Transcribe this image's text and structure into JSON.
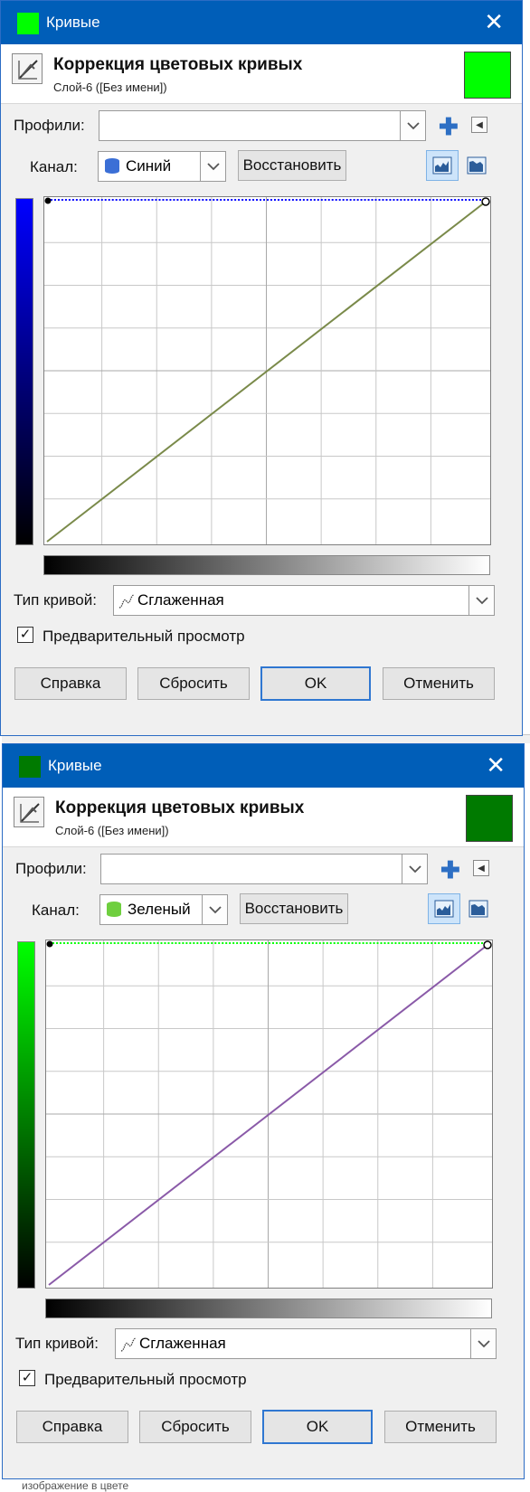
{
  "dialogs": [
    {
      "window_title": "Кривые",
      "color": "#00ff00",
      "header_title": "Коррекция цветовых кривых",
      "header_subtitle": "Слой-6 ([Без имени])",
      "profiles_label": "Профили:",
      "profiles_value": "",
      "channel_label": "Канал:",
      "channel_value": "Синий",
      "channel_icon": "blue-channel-icon",
      "channel_icon_color": "#3b6fd6",
      "reset_channel_label": "Восстановить",
      "gradient_color": "#0000ff",
      "curve_color": "#7a8a4a",
      "curve_type_label": "Тип кривой:",
      "curve_type_value": "Сглаженная",
      "preview_label": "Предварительный просмотр",
      "preview_checked": true,
      "buttons": {
        "help": "Справка",
        "reset": "Сбросить",
        "ok": "OK",
        "cancel": "Отменить"
      }
    },
    {
      "window_title": "Кривые",
      "color": "#007a00",
      "header_title": "Коррекция цветовых кривых",
      "header_subtitle": "Слой-6 ([Без имени])",
      "profiles_label": "Профили:",
      "profiles_value": "",
      "channel_label": "Канал:",
      "channel_value": "Зеленый",
      "channel_icon": "green-channel-icon",
      "channel_icon_color": "#6fcf3f",
      "reset_channel_label": "Восстановить",
      "gradient_color": "#00ff00",
      "curve_color": "#8a5aa8",
      "curve_type_label": "Тип кривой:",
      "curve_type_value": "Сглаженная",
      "preview_label": "Предварительный просмотр",
      "preview_checked": true,
      "buttons": {
        "help": "Справка",
        "reset": "Сбросить",
        "ok": "OK",
        "cancel": "Отменить"
      }
    }
  ],
  "background_text": "изображение в цвете"
}
